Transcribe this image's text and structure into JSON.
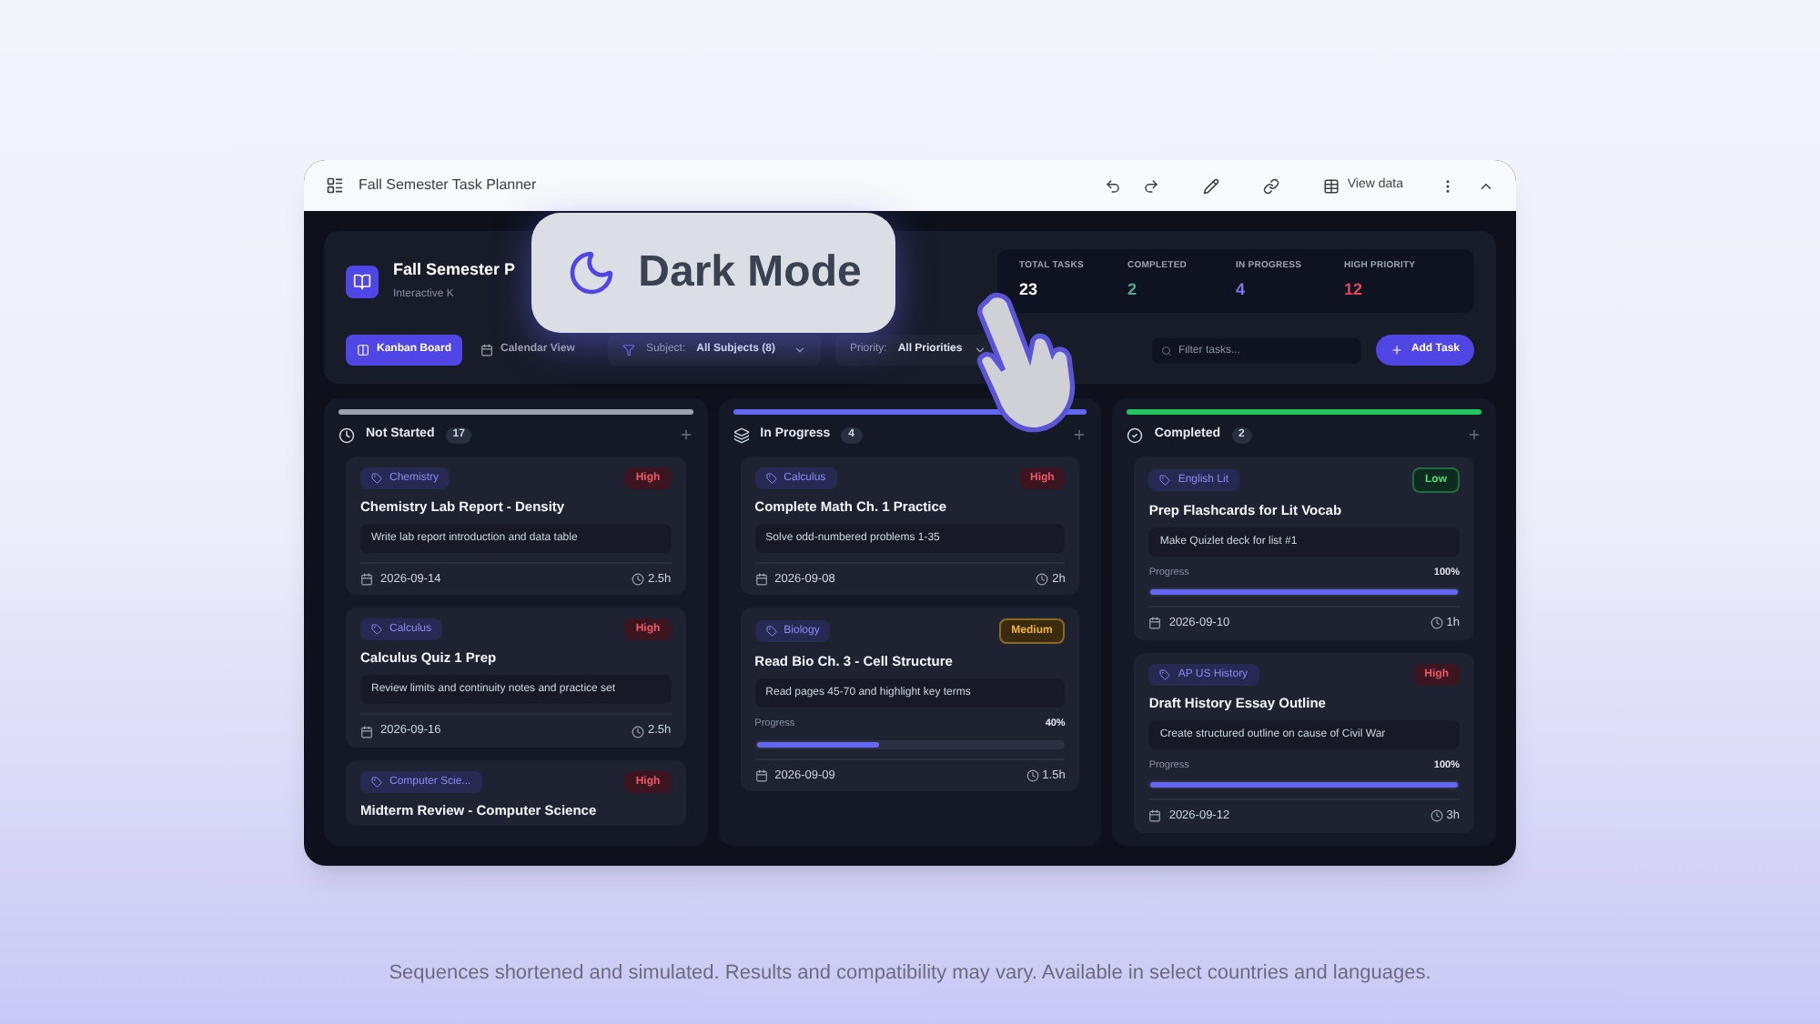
{
  "window": {
    "title": "Fall Semester Task Planner",
    "toolbar": {
      "view_data": "View data"
    }
  },
  "header": {
    "title": "Fall Semester P",
    "subtitle": "Interactive K"
  },
  "stats": [
    {
      "label": "TOTAL TASKS",
      "value": "23",
      "color": "#ffffff"
    },
    {
      "label": "COMPLETED",
      "value": "2",
      "color": "#4fa88a"
    },
    {
      "label": "IN PROGRESS",
      "value": "4",
      "color": "#7f7cf0"
    },
    {
      "label": "HIGH PRIORITY",
      "value": "12",
      "color": "#e0475a"
    }
  ],
  "views": [
    {
      "label": "Kanban Board",
      "selected": true
    },
    {
      "label": "Calendar View",
      "selected": false
    }
  ],
  "filters": {
    "subject_label": "Subject:",
    "subject_value": "All Subjects (8)",
    "priority_label": "Priority:",
    "priority_value": "All Priorities",
    "search_placeholder": "Filter tasks...",
    "add_button": "Add Task"
  },
  "overlay": {
    "badge": "Dark Mode"
  },
  "columns": [
    {
      "title": "Not Started",
      "count": "17",
      "color": "#9ca3af",
      "kind": "clock",
      "cards": [
        {
          "tag": "Chemistry",
          "priority": "High",
          "title": "Chemistry Lab Report - Density",
          "description": "Write lab report introduction and data table",
          "date": "2026-09-14",
          "hours": "2.5h"
        },
        {
          "tag": "Calculus",
          "priority": "High",
          "title": "Calculus Quiz 1 Prep",
          "description": "Review limits and continuity notes and practice set",
          "date": "2026-09-16",
          "hours": "2.5h"
        },
        {
          "tag": "Computer Scie...",
          "priority": "High",
          "title": "Midterm Review - Computer Science"
        }
      ]
    },
    {
      "title": "In Progress",
      "count": "4",
      "color": "#6366f1",
      "kind": "stack",
      "cards": [
        {
          "tag": "Calculus",
          "priority": "High",
          "title": "Complete Math Ch. 1 Practice",
          "description": "Solve odd-numbered problems 1-35",
          "date": "2026-09-08",
          "hours": "2h"
        },
        {
          "tag": "Biology",
          "priority": "Medium",
          "title": "Read Bio Ch. 3 - Cell Structure",
          "description": "Read pages 45-70 and highlight key terms",
          "progress_label": "Progress",
          "progress_text": "40%",
          "level": 0.4,
          "date": "2026-09-09",
          "hours": "1.5h"
        }
      ]
    },
    {
      "title": "Completed",
      "count": "2",
      "color": "#22c55e",
      "kind": "check",
      "cards": [
        {
          "tag": "English Lit",
          "priority": "Low",
          "title": "Prep Flashcards for Lit Vocab",
          "description": "Make Quizlet deck for list #1",
          "progress_label": "Progress",
          "progress_text": "100%",
          "level": 1,
          "date": "2026-09-10",
          "hours": "1h"
        },
        {
          "tag": "AP US History",
          "priority": "High",
          "title": "Draft History Essay Outline",
          "description": "Create structured outline on cause of Civil War",
          "progress_label": "Progress",
          "progress_text": "100%",
          "level": 1,
          "date": "2026-09-12",
          "hours": "3h"
        }
      ]
    }
  ],
  "footer": "Sequences shortened and simulated. Results and compatibility may vary. Available in select countries and languages."
}
